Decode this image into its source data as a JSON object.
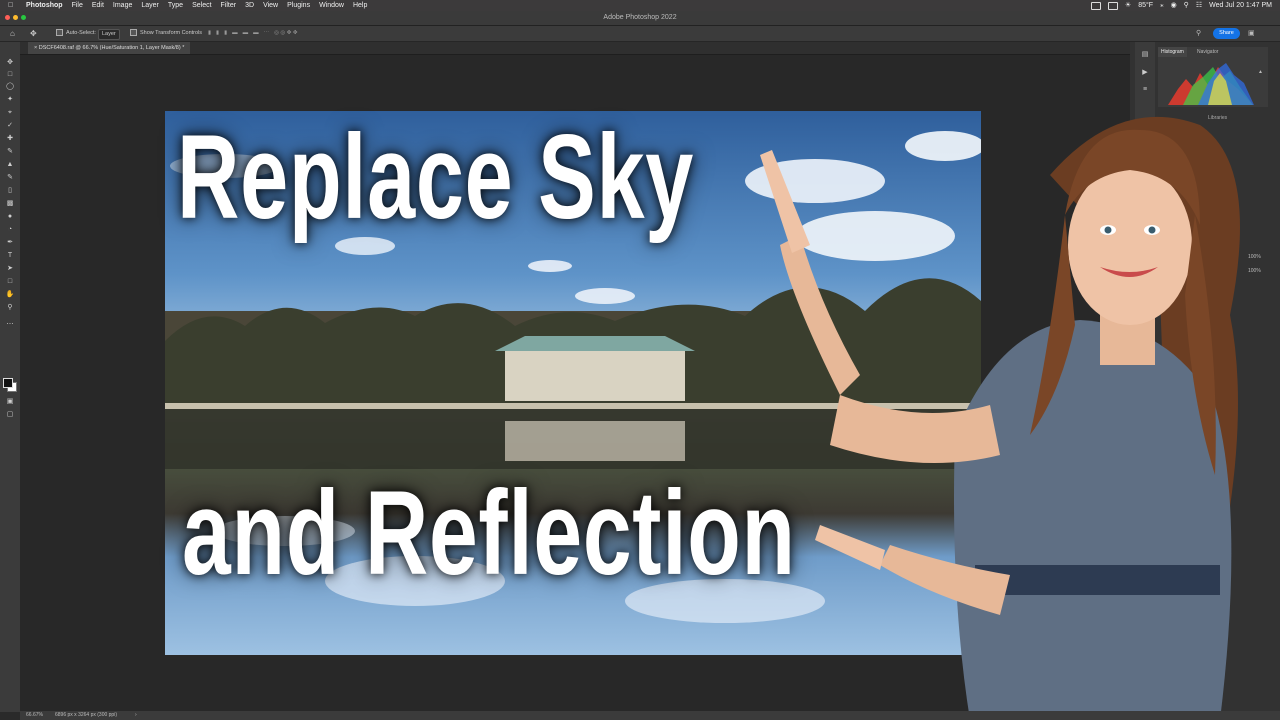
{
  "menubar": {
    "apple_icon": "apple-icon",
    "items": [
      "Photoshop",
      "File",
      "Edit",
      "Image",
      "Layer",
      "Type",
      "Select",
      "Filter",
      "3D",
      "View",
      "Plugins",
      "Window",
      "Help"
    ],
    "weather": "85°F",
    "clock": "Wed Jul 20  1:47 PM"
  },
  "window": {
    "title": "Adobe Photoshop 2022"
  },
  "options": {
    "auto_select_label": "Auto-Select:",
    "layer_select_value": "Layer",
    "show_transform_label": "Show Transform Controls",
    "share_label": "Share"
  },
  "document": {
    "tab_title": "DSCF6408.raf @ 66.7% (Hue/Saturation 1, Layer Mask/8) *"
  },
  "panels": {
    "histogram_tab": "Histogram",
    "navigator_tab": "Navigator",
    "libraries_tab": "Libraries",
    "opacity_value": "100%",
    "fill_value": "100%"
  },
  "canvas": {
    "headline_1": "Replace Sky",
    "headline_2": "and Reflection"
  },
  "status": {
    "zoom": "66.67%",
    "dimensions": "6896 px x 3264 px (300 ppi)"
  },
  "colors": {
    "share_button": "#1473e6",
    "foreground_swatch": "#111111",
    "background_swatch": "#ffffff"
  },
  "tools": [
    "move-icon",
    "marquee-icon",
    "lasso-icon",
    "quick-select-icon",
    "crop-icon",
    "eyedropper-icon",
    "healing-brush-icon",
    "brush-icon",
    "clone-stamp-icon",
    "history-brush-icon",
    "eraser-icon",
    "gradient-icon",
    "blur-icon",
    "dodge-icon",
    "pen-icon",
    "type-icon",
    "path-select-icon",
    "rectangle-icon",
    "hand-icon",
    "zoom-icon"
  ]
}
